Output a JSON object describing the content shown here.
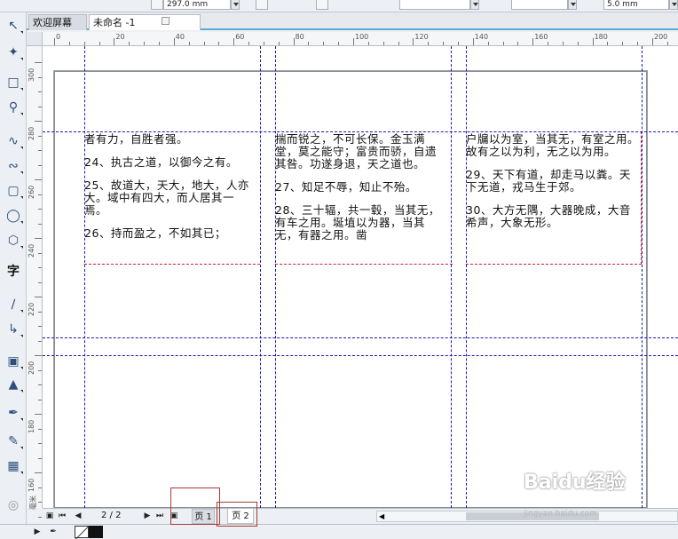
{
  "propbar": {
    "height_value": "297.0 mm",
    "nudge_value": "5.0 mm"
  },
  "tabs": {
    "welcome": "欢迎屏幕",
    "document": "未命名 -1"
  },
  "hruler": {
    "labels": [
      "0",
      "20",
      "40",
      "60",
      "80",
      "100",
      "120",
      "140",
      "160",
      "180",
      "200"
    ]
  },
  "vruler": {
    "labels": [
      "300",
      "280",
      "260",
      "240",
      "220",
      "200",
      "180",
      "160"
    ],
    "unit": "毫米"
  },
  "columns": [
    {
      "paragraphs": [
        "者有力，自胜者强。",
        "24、执古之道，以御今之有。",
        "25、故道大，天大，地大，人亦大。域中有四大，而人居其一焉。",
        "26、持而盈之，不如其已；"
      ]
    },
    {
      "paragraphs": [
        "揣而锐之，不可长保。金玉满堂，莫之能守；富贵而骄，自遗其咎。功遂身退，天之道也。",
        "27、知足不辱，知止不殆。",
        "28、三十辐，共一毂，当其无，有车之用。埏埴以为器，当其无，有器之用。凿"
      ]
    },
    {
      "paragraphs": [
        "户牖以为室，当其无，有室之用。故有之以为利，无之以为用。",
        "29、天下有道，却走马以粪。天下无道，戎马生于郊。",
        "30、大方无隅，大器晚成，大音希声，大象无形。"
      ]
    }
  ],
  "pagenav": {
    "count": "2 / 2",
    "page1": "页 1",
    "page2": "页 2"
  },
  "watermark": {
    "brand": "Baidu经验",
    "url": "jingyan.baidu.com"
  },
  "colors": {
    "guide": "#1a1aaa",
    "frame": "#cc2233",
    "accent": "#5aa9d6"
  }
}
